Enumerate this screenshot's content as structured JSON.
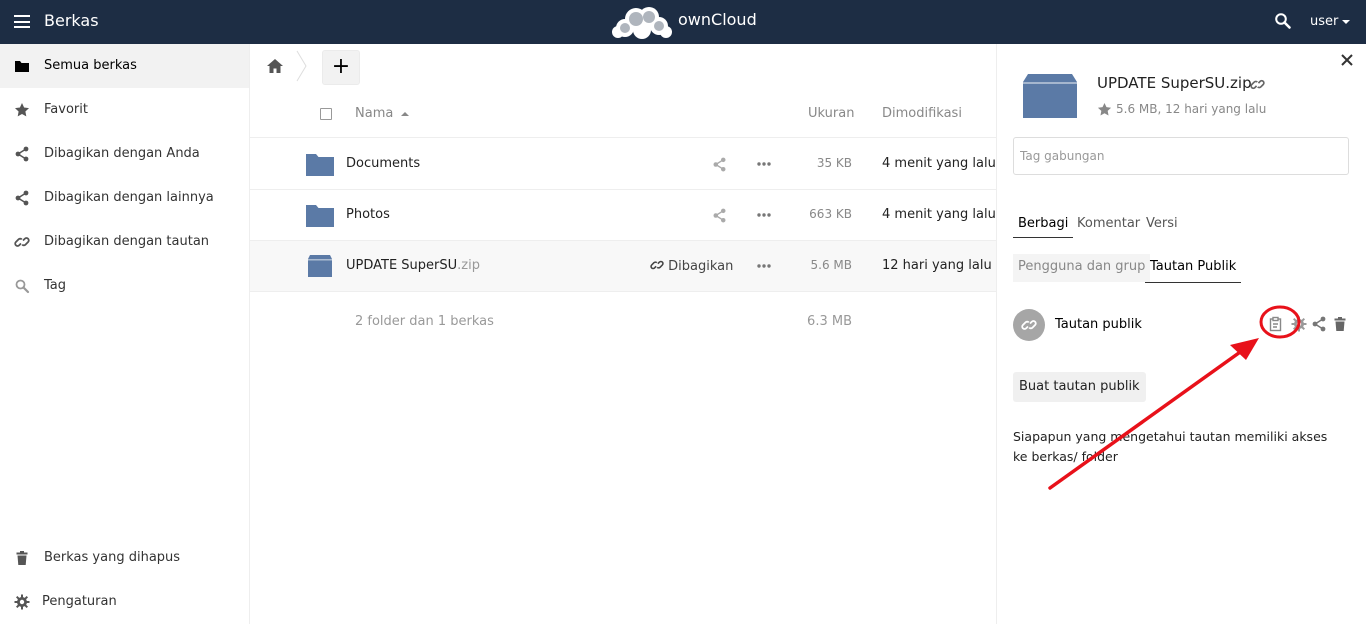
{
  "header": {
    "app_name": "Berkas",
    "brand": "ownCloud",
    "user": "user"
  },
  "sidebar": {
    "items": [
      {
        "label": "Semua berkas",
        "icon": "folder-icon",
        "active": true
      },
      {
        "label": "Favorit",
        "icon": "star-icon"
      },
      {
        "label": "Dibagikan dengan Anda",
        "icon": "share-icon"
      },
      {
        "label": "Dibagikan dengan lainnya",
        "icon": "share-icon"
      },
      {
        "label": "Dibagikan dengan tautan",
        "icon": "link-icon"
      },
      {
        "label": "Tag",
        "icon": "search-icon"
      }
    ],
    "bottom": [
      {
        "label": "Berkas yang dihapus",
        "icon": "trash-icon"
      },
      {
        "label": "Pengaturan",
        "icon": "gear-icon"
      }
    ]
  },
  "toolbar": {
    "add_label": "+"
  },
  "table": {
    "headers": {
      "name": "Nama",
      "size": "Ukuran",
      "modified": "Dimodifikasi"
    },
    "rows": [
      {
        "name": "Documents",
        "ext": "",
        "size": "35 KB",
        "modified": "4 menit yang lalu",
        "type": "folder"
      },
      {
        "name": "Photos",
        "ext": "",
        "size": "663 KB",
        "modified": "4 menit yang lalu",
        "type": "folder"
      },
      {
        "name": "UPDATE SuperSU",
        "ext": ".zip",
        "size": "5.6 MB",
        "modified": "12 hari yang lalu",
        "type": "zip",
        "shared_label": "Dibagikan"
      }
    ],
    "summary": {
      "text": "2 folder dan 1 berkas",
      "size": "6.3 MB"
    }
  },
  "panel": {
    "title": "UPDATE SuperSU.zip",
    "meta": "5.6 MB, 12 hari yang lalu",
    "tag_placeholder": "Tag gabungan",
    "tabs": [
      "Berbagi",
      "Komentar",
      "Versi"
    ],
    "subtabs": [
      "Pengguna dan grup",
      "Tautan Publik"
    ],
    "public_link_label": "Tautan publik",
    "create_button": "Buat tautan publik",
    "info": "Siapapun yang mengetahui tautan memiliki akses ke berkas/ folder"
  },
  "colors": {
    "header_bg": "#1d2d44",
    "folder": "#5b7aa6",
    "annotation": "#e8111a"
  }
}
